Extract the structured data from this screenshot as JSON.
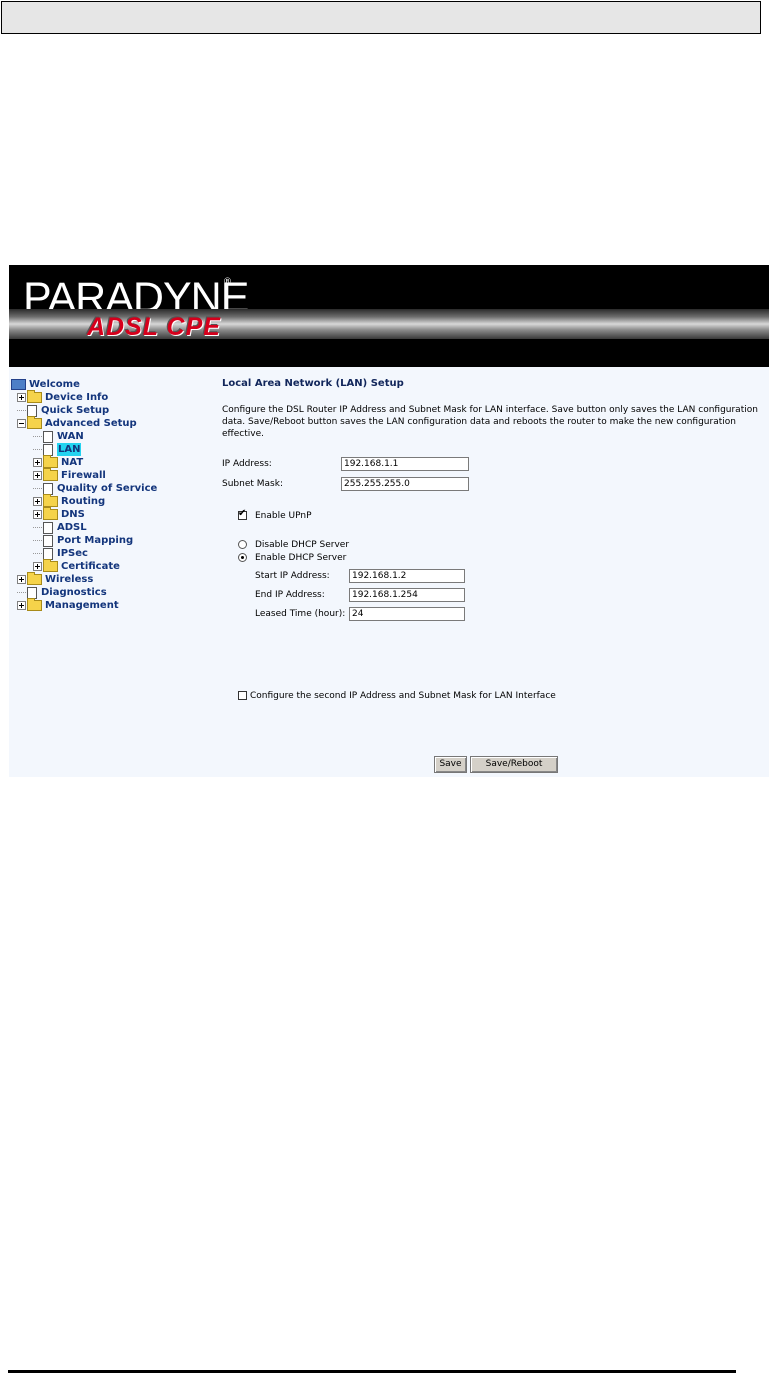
{
  "banner": {
    "brand": "PARADYNE",
    "registered": "®",
    "product": "ADSL CPE"
  },
  "nav": {
    "items": [
      {
        "label": "Welcome"
      },
      {
        "label": "Device Info"
      },
      {
        "label": "Quick Setup"
      },
      {
        "label": "Advanced Setup"
      },
      {
        "label": "WAN"
      },
      {
        "label": "LAN"
      },
      {
        "label": "NAT"
      },
      {
        "label": "Firewall"
      },
      {
        "label": "Quality of Service"
      },
      {
        "label": "Routing"
      },
      {
        "label": "DNS"
      },
      {
        "label": "ADSL"
      },
      {
        "label": "Port Mapping"
      },
      {
        "label": "IPSec"
      },
      {
        "label": "Certificate"
      },
      {
        "label": "Wireless"
      },
      {
        "label": "Diagnostics"
      },
      {
        "label": "Management"
      }
    ],
    "selected": "LAN"
  },
  "page": {
    "title": "Local Area Network (LAN) Setup",
    "description": "Configure the DSL Router IP Address and Subnet Mask for LAN interface.  Save button only saves the LAN configuration data.  Save/Reboot button saves the LAN configuration data and reboots the router to make the new configuration effective."
  },
  "form": {
    "ip_address_label": "IP Address:",
    "ip_address_value": "192.168.1.1",
    "subnet_mask_label": "Subnet Mask:",
    "subnet_mask_value": "255.255.255.0",
    "upnp_label": "Enable UPnP",
    "upnp_checked": true,
    "disable_dhcp_label": "Disable DHCP Server",
    "enable_dhcp_label": "Enable DHCP Server",
    "dhcp_selected": "enable",
    "start_ip_label": "Start IP Address:",
    "start_ip_value": "192.168.1.2",
    "end_ip_label": "End IP Address:",
    "end_ip_value": "192.168.1.254",
    "lease_label": "Leased Time (hour):",
    "lease_value": "24",
    "second_ip_label": "Configure the second IP Address and Subnet Mask for LAN Interface",
    "second_ip_checked": false
  },
  "buttons": {
    "save": "Save",
    "save_reboot": "Save/Reboot"
  }
}
